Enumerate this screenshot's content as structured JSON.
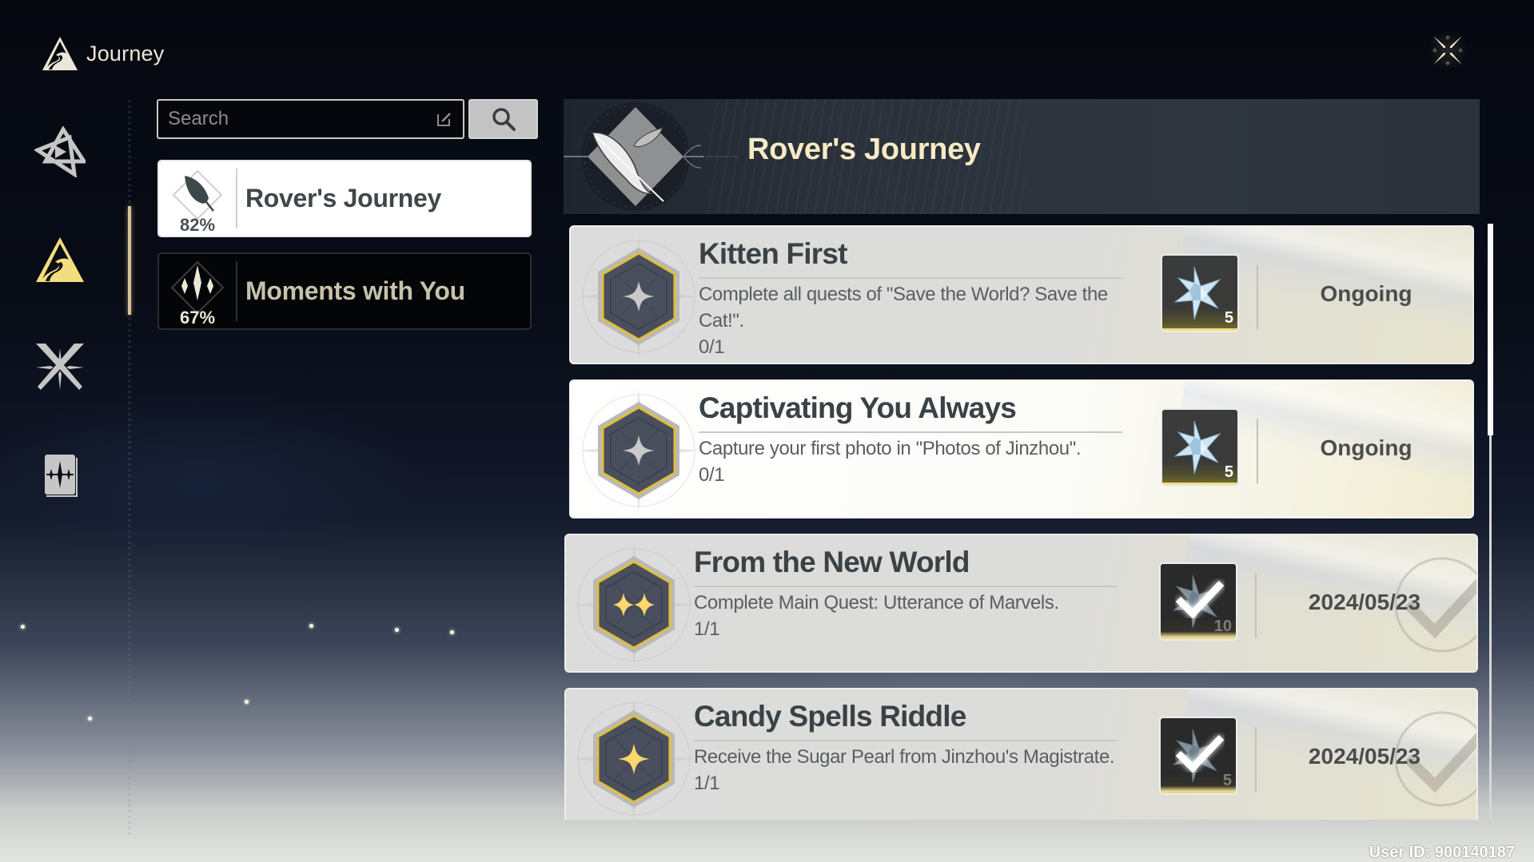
{
  "app": {
    "title": "Journey",
    "logo_icon": "mountain-path-icon",
    "close_icon": "close-star-icon"
  },
  "nav": {
    "items": [
      {
        "id": "nav-tutorial",
        "icon": "triangle-play-icon",
        "active": false
      },
      {
        "id": "nav-journey",
        "icon": "mountain-path-icon",
        "active": true
      },
      {
        "id": "nav-combat",
        "icon": "crossed-swords-icon",
        "active": false
      },
      {
        "id": "nav-archive",
        "icon": "book-sparkle-icon",
        "active": false
      }
    ]
  },
  "search": {
    "placeholder": "Search",
    "value": "",
    "edit_icon": "edit-icon",
    "button_icon": "search-icon"
  },
  "categories": [
    {
      "label": "Rover's Journey",
      "percent": "82%",
      "icon": "feather-icon",
      "active": true
    },
    {
      "label": "Moments with You",
      "percent": "67%",
      "icon": "sparkles-icon",
      "active": false
    }
  ],
  "banner": {
    "title": "Rover's Journey",
    "icon": "feather-emblem-icon"
  },
  "quests": [
    {
      "title": "Kitten First",
      "description": "Complete all quests of \"Save the World? Save the Cat!\".",
      "progress": "0/1",
      "reward_count": "5",
      "reward_icon": "astrite-star-icon",
      "reward_claimed": false,
      "status": "Ongoing",
      "badge_stars": 1,
      "badge_star_color": "#c9c9c9"
    },
    {
      "title": "Captivating You Always",
      "description": "Capture your first photo in \"Photos of Jinzhou\".",
      "progress": "0/1",
      "reward_count": "5",
      "reward_icon": "astrite-star-icon",
      "reward_claimed": false,
      "status": "Ongoing",
      "badge_stars": 1,
      "badge_star_color": "#c9c9c9"
    },
    {
      "title": "From the New World",
      "description": "Complete Main Quest: Utterance of Marvels.",
      "progress": "1/1",
      "reward_count": "10",
      "reward_icon": "astrite-star-icon",
      "reward_claimed": true,
      "status": "2024/05/23",
      "badge_stars": 2,
      "badge_star_color": "#ffd76a"
    },
    {
      "title": "Candy Spells Riddle",
      "description": "Receive the Sugar Pearl from Jinzhou's Magistrate.",
      "progress": "1/1",
      "reward_count": "5",
      "reward_icon": "astrite-star-icon",
      "reward_claimed": true,
      "status": "2024/05/23",
      "badge_stars": 1,
      "badge_star_color": "#ffd76a"
    }
  ],
  "footer": {
    "user_id": "User ID: 900140187"
  },
  "colors": {
    "accent_gold": "#f2dc86",
    "active_nav": "#f4dd7e",
    "banner_title": "#f6ebc4"
  }
}
